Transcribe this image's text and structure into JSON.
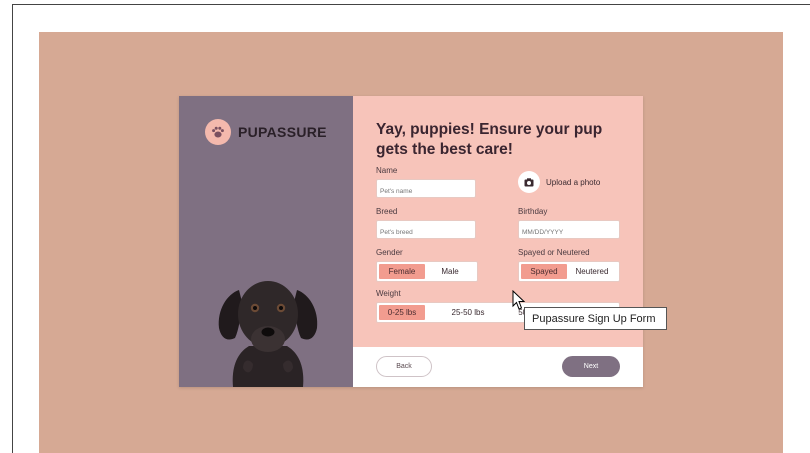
{
  "brand": {
    "name": "PUPASSURE"
  },
  "form": {
    "title": "Yay, puppies! Ensure your pup gets the best care!",
    "name": {
      "label": "Name",
      "placeholder": "Pet's name"
    },
    "upload": {
      "label": "Upload a photo",
      "icon": "camera-icon"
    },
    "breed": {
      "label": "Breed",
      "placeholder": "Pet's breed"
    },
    "birthday": {
      "label": "Birthday",
      "placeholder": "MM/DD/YYYY"
    },
    "gender": {
      "label": "Gender",
      "options": [
        "Female",
        "Male"
      ],
      "selected": "Female"
    },
    "spayed": {
      "label": "Spayed or Neutered",
      "options": [
        "Spayed",
        "Neutered"
      ],
      "selected": "Spayed"
    },
    "weight": {
      "label": "Weight",
      "options": [
        "0-25 lbs",
        "25-50 lbs",
        "50+"
      ],
      "selected": "0-25 lbs"
    }
  },
  "footer": {
    "back": "Back",
    "next": "Next"
  },
  "tooltip": {
    "text": "Pupassure Sign Up Form"
  },
  "colors": {
    "canvas": "#d6a994",
    "panel": "#7f7082",
    "form": "#f7c4ba",
    "accent": "#f29c8f"
  }
}
